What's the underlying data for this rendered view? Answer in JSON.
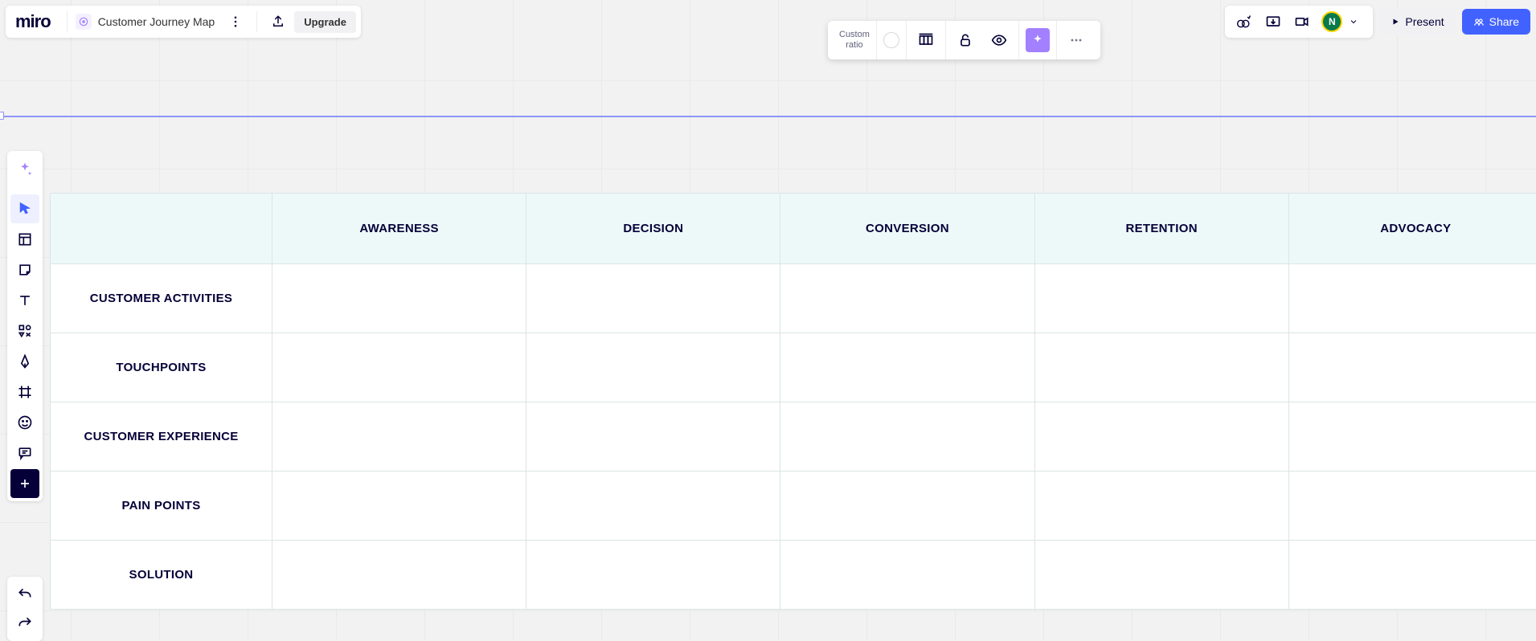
{
  "app": {
    "logo": "miro",
    "board_title": "Customer Journey Map",
    "upgrade_label": "Upgrade"
  },
  "topright": {
    "avatar_initial": "N",
    "present_label": "Present",
    "share_label": "Share"
  },
  "frame_toolbar": {
    "ratio_label": "Custom\nratio"
  },
  "journey": {
    "columns": [
      "AWARENESS",
      "DECISION",
      "CONVERSION",
      "RETENTION",
      "ADVOCACY"
    ],
    "rows": [
      "CUSTOMER ACTIVITIES",
      "TOUCHPOINTS",
      "CUSTOMER EXPERIENCE",
      "PAIN POINTS",
      "SOLUTION"
    ]
  }
}
